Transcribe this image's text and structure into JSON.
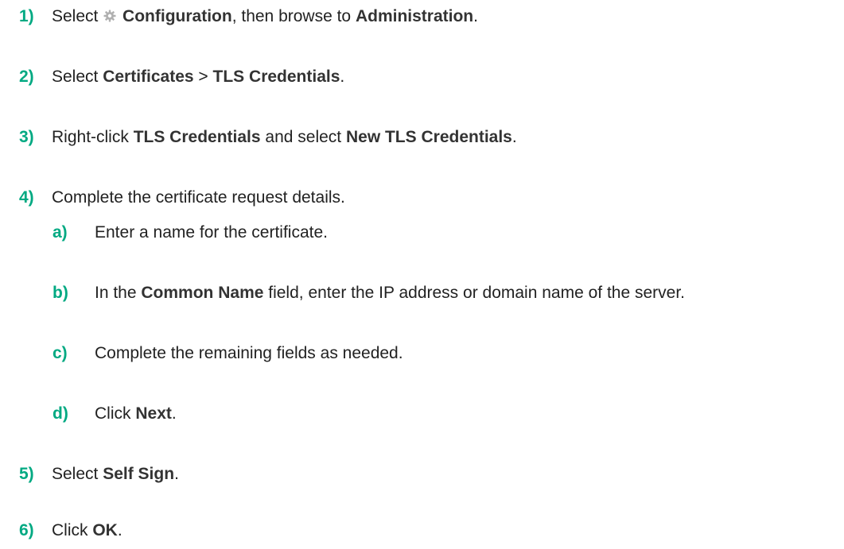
{
  "accent_color": "#01a982",
  "steps": [
    {
      "num": "1)",
      "parts": [
        "Select ",
        "",
        "Configuration",
        ", then browse to ",
        "Administration",
        "."
      ],
      "icon": "gear-icon"
    },
    {
      "num": "2)",
      "parts": [
        "Select ",
        "Certificates",
        " > ",
        "TLS Credentials",
        "."
      ]
    },
    {
      "num": "3)",
      "parts": [
        "Right-click ",
        "TLS Credentials",
        " and select ",
        "New TLS Credentials",
        "."
      ]
    },
    {
      "num": "4)",
      "parts": [
        "Complete the certificate request details."
      ],
      "substeps": [
        {
          "num": "a)",
          "parts": [
            "Enter a name for the certificate."
          ]
        },
        {
          "num": "b)",
          "parts": [
            "In the ",
            "Common Name",
            " field, enter the IP address or domain name of the server."
          ]
        },
        {
          "num": "c)",
          "parts": [
            "Complete the remaining fields as needed."
          ]
        },
        {
          "num": "d)",
          "parts": [
            "Click ",
            "Next",
            "."
          ]
        }
      ]
    },
    {
      "num": "5)",
      "parts": [
        "Select ",
        "Self Sign",
        "."
      ]
    },
    {
      "num": "6)",
      "parts": [
        "Click ",
        "OK",
        "."
      ]
    }
  ]
}
